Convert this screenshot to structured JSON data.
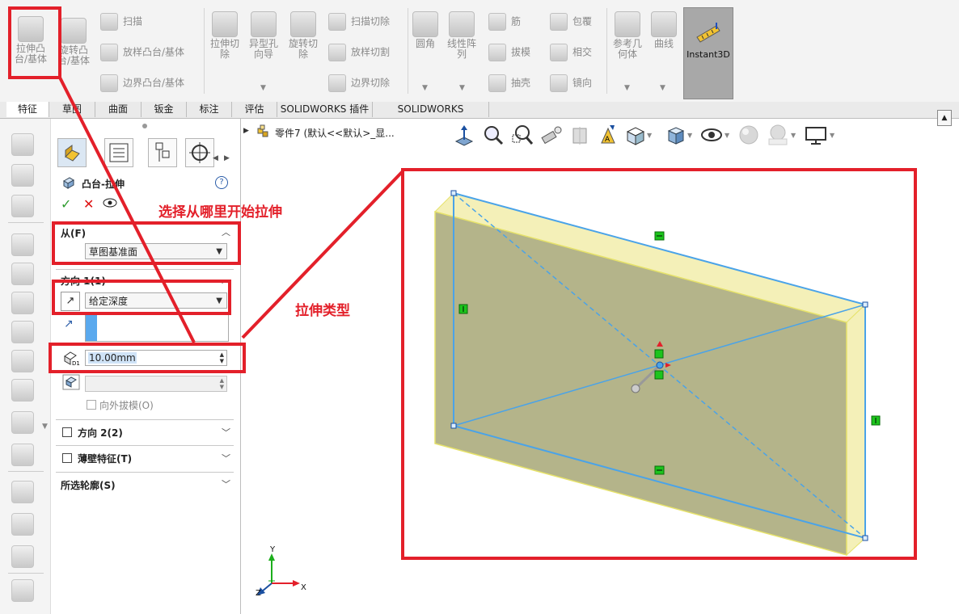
{
  "ribbon": {
    "extrude_boss": "拉伸凸台/基体",
    "revolve_boss": "旋转凸台/基体",
    "sweep": "扫描",
    "loft_boss": "放样凸台/基体",
    "boundary_boss": "边界凸台/基体",
    "extrude_cut": "拉伸切除",
    "hole_wizard": "异型孔向导",
    "revolve_cut": "旋转切除",
    "sweep_cut": "扫描切除",
    "loft_cut": "放样切割",
    "boundary_cut": "边界切除",
    "fillet": "圆角",
    "linear_pattern": "线性阵列",
    "rib": "筋",
    "draft": "拔模",
    "shell": "抽壳",
    "wrap": "包覆",
    "intersect": "相交",
    "mirror": "镜向",
    "ref_geometry": "参考几何体",
    "curves": "曲线",
    "instant3d": "Instant3D"
  },
  "tabs": [
    "特征",
    "草图",
    "曲面",
    "钣金",
    "标注",
    "评估",
    "SOLIDWORKS 插件",
    "SOLIDWORKS Inspection"
  ],
  "tree": {
    "label": "零件7 (默认<<默认>_显..."
  },
  "pm": {
    "title": "凸台-拉伸",
    "help": "?",
    "from_label": "从(F)",
    "from_value": "草图基准面",
    "direction_label": "方向 1(1)",
    "end_condition": "给定深度",
    "depth_value": "10.00mm",
    "draft_outward": "向外拔模(O)",
    "direction2": "方向 2(2)",
    "thin_feature": "薄壁特征(T)",
    "selected_contours": "所选轮廓(S)"
  },
  "annotations": {
    "from_note": "选择从哪里开始拉伸",
    "type_note": "拉伸类型"
  },
  "axes": {
    "x": "X",
    "y": "Y",
    "z": "Z"
  },
  "colors": {
    "annotation": "#e3202a",
    "body": "#b4b48a",
    "sketch": "#4aa3e8"
  }
}
